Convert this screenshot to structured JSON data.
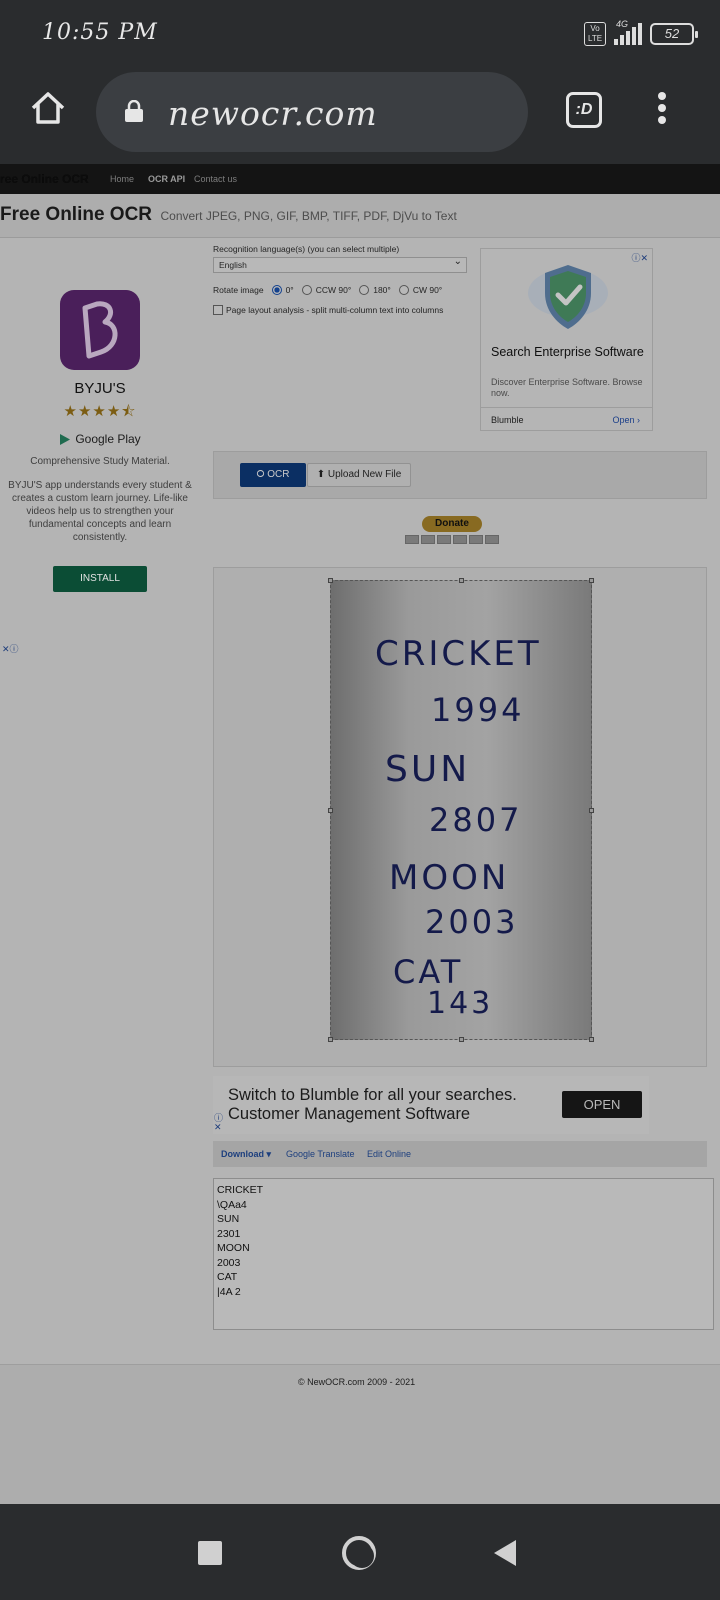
{
  "status": {
    "time": "10:55 PM",
    "volte": "Vo LTE",
    "network": "4G",
    "battery": "52"
  },
  "browser": {
    "url": "newocr.com",
    "tabs_label": ":D"
  },
  "nav": {
    "brand": "ree Online OCR",
    "links": [
      "Home",
      "OCR API",
      "Contact us"
    ]
  },
  "header": {
    "title": "Free Online OCR",
    "subtitle": "Convert JPEG, PNG, GIF, BMP, TIFF, PDF, DjVu to Text"
  },
  "side_ad": {
    "app_name": "BYJU'S",
    "rating": "★★★★⯪",
    "store": "Google Play",
    "desc1": "Comprehensive Study Material.",
    "desc2": "BYJU'S app understands every student & creates a custom learn journey. Life-like videos help us to strengthen your fundamental concepts and learn consistently.",
    "install": "INSTALL",
    "close": "✕ⓘ"
  },
  "form": {
    "lang_label": "Recognition language(s) (you can select multiple)",
    "lang_value": "English",
    "rotate_label": "Rotate image",
    "rot_0": "0°",
    "rot_ccw": "CCW 90°",
    "rot_180": "180°",
    "rot_cw": "CW 90°",
    "layout_label": "Page layout analysis - split multi-column text into columns"
  },
  "right_ad": {
    "title": "Search Enterprise Software",
    "sub": "Discover Enterprise Software. Browse now.",
    "brand": "Blumble",
    "open": "Open  ›",
    "icons": "ⓘ✕"
  },
  "actions": {
    "ocr": "⭘ OCR",
    "upload": "⬆ Upload New File"
  },
  "donate": {
    "label": "Donate"
  },
  "bottom_ad": {
    "text": "Switch to Blumble for all your searches. Customer Management Software",
    "open": "OPEN",
    "icons": "ⓘ ✕"
  },
  "dl": {
    "download": "Download ▾",
    "translate": "Google Translate",
    "edit": "Edit Online"
  },
  "result_text": "CRICKET\n\\QAa4\nSUN\n2301\nMOON\n2003\nCAT\n|4A 2",
  "photo_lines": [
    "CRICKET",
    "1994",
    "SUN",
    "2807",
    "MOON",
    "2003",
    "CAT",
    "143"
  ],
  "footer": {
    "copyright": "© NewOCR.com 2009 - 2021"
  }
}
